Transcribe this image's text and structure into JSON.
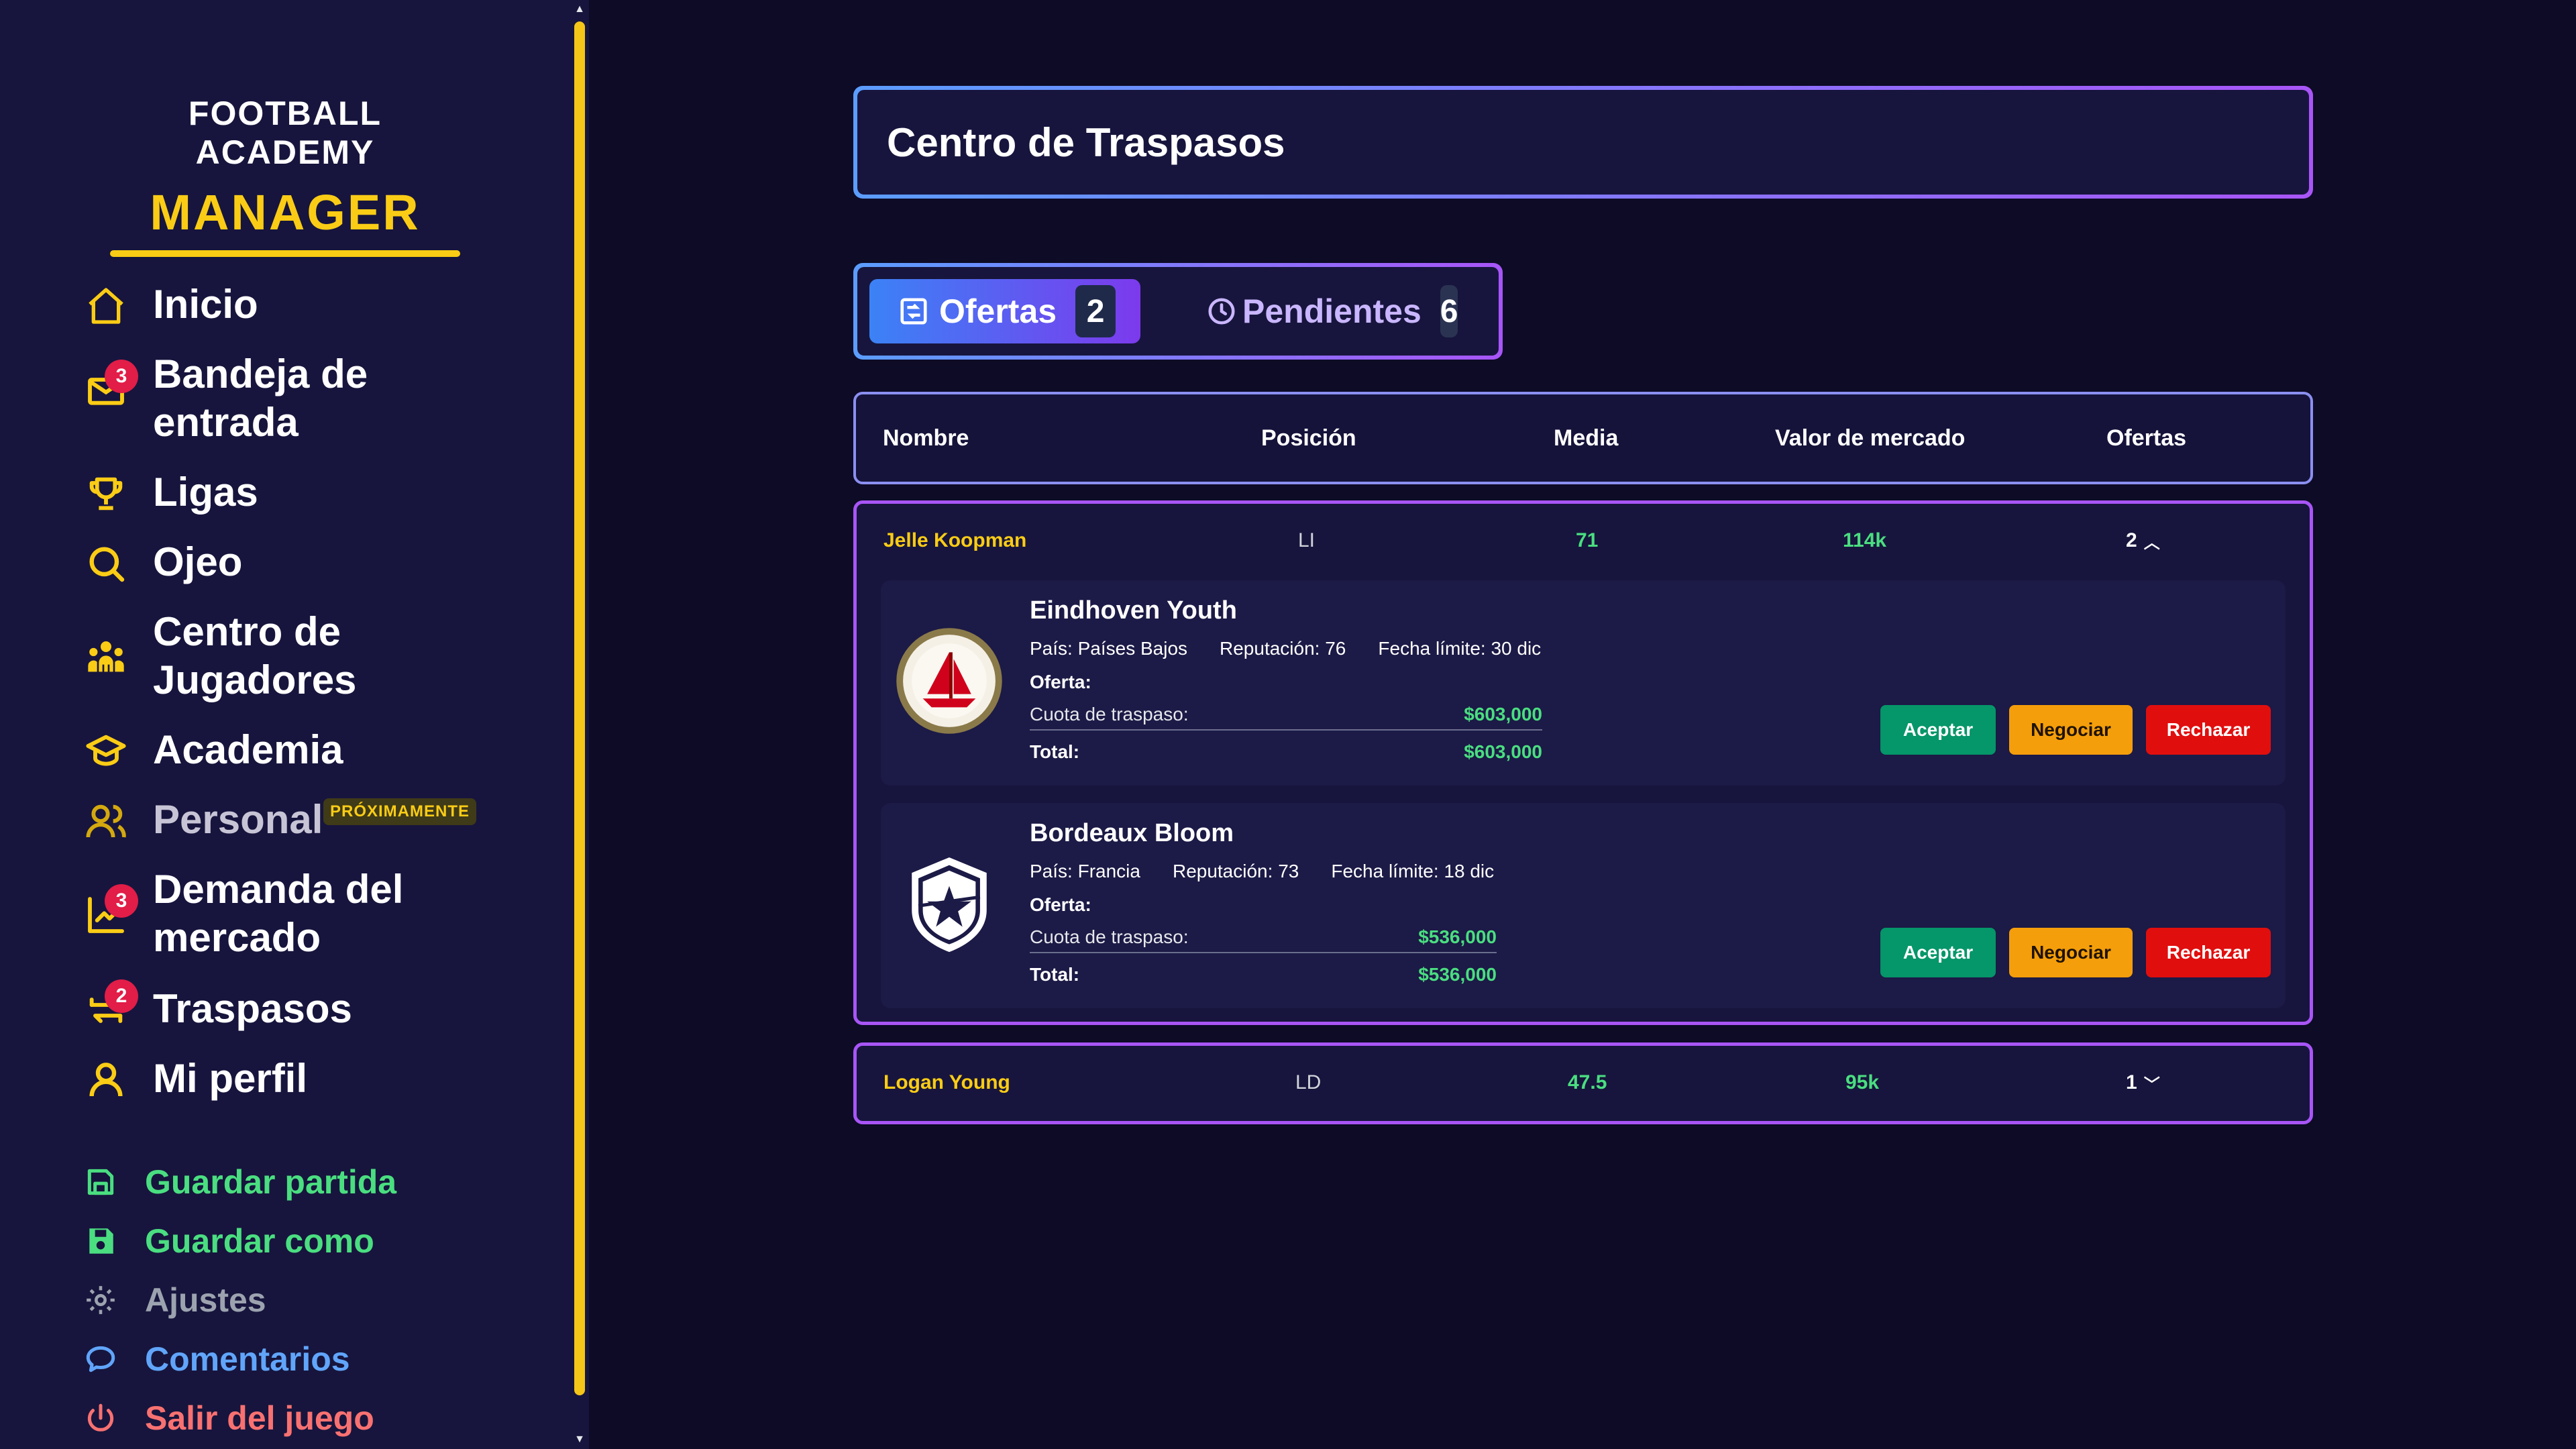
{
  "brand": {
    "top": "FOOTBALL ACADEMY",
    "main": "MANAGER"
  },
  "nav": [
    {
      "label": "Inicio",
      "icon": "home-icon"
    },
    {
      "label": "Bandeja de entrada",
      "icon": "mail-icon",
      "badge": "3"
    },
    {
      "label": "Ligas",
      "icon": "trophy-icon"
    },
    {
      "label": "Ojeo",
      "icon": "search-icon"
    },
    {
      "label": "Centro de Jugadores",
      "icon": "players-icon"
    },
    {
      "label": "Academia",
      "icon": "graduation-cap-icon"
    },
    {
      "label": "Personal",
      "icon": "staff-icon",
      "tag": "PRÓXIMAMENTE"
    },
    {
      "label": "Demanda del mercado",
      "icon": "chart-icon",
      "badge": "3"
    },
    {
      "label": "Traspasos",
      "icon": "transfer-icon",
      "badge": "2"
    },
    {
      "label": "Mi perfil",
      "icon": "user-icon"
    }
  ],
  "utility": [
    {
      "label": "Guardar partida",
      "icon": "save-icon",
      "color": "#4ade80"
    },
    {
      "label": "Guardar como",
      "icon": "save-as-icon",
      "color": "#4ade80"
    },
    {
      "label": "Ajustes",
      "icon": "gear-icon",
      "color": "#9ca3af"
    },
    {
      "label": "Comentarios",
      "icon": "comment-icon",
      "color": "#60a5fa"
    },
    {
      "label": "Salir del juego",
      "icon": "power-icon",
      "color": "#f87171"
    }
  ],
  "page": {
    "title": "Centro de Traspasos"
  },
  "tabs": [
    {
      "label": "Ofertas",
      "count": "2",
      "icon": "offers-icon",
      "active": true
    },
    {
      "label": "Pendientes",
      "count": "6",
      "icon": "clock-icon",
      "active": false
    }
  ],
  "table": {
    "headers": [
      "Nombre",
      "Posición",
      "Media",
      "Valor de mercado",
      "Ofertas"
    ]
  },
  "players": [
    {
      "name": "Jelle Koopman",
      "position": "LI",
      "rating": "71",
      "value": "114k",
      "offers": "2",
      "expanded": true,
      "offer_list": [
        {
          "club": "Eindhoven Youth",
          "country_key": "País:",
          "country": "Países Bajos",
          "rep_key": "Reputación:",
          "rep": "76",
          "deadline_key": "Fecha límite:",
          "deadline": "30 dic",
          "offer_label": "Oferta:",
          "fee_label": "Cuota de traspaso:",
          "fee": "$603,000",
          "total_label": "Total:",
          "total": "$603,000",
          "logo": "sailboat-crest-icon"
        },
        {
          "club": "Bordeaux Bloom",
          "country_key": "País:",
          "country": "Francia",
          "rep_key": "Reputación:",
          "rep": "73",
          "deadline_key": "Fecha límite:",
          "deadline": "18 dic",
          "offer_label": "Oferta:",
          "fee_label": "Cuota de traspaso:",
          "fee": "$536,000",
          "total_label": "Total:",
          "total": "$536,000",
          "logo": "star-shield-crest-icon"
        }
      ]
    },
    {
      "name": "Logan Young",
      "position": "LD",
      "rating": "47.5",
      "value": "95k",
      "offers": "1",
      "expanded": false
    }
  ],
  "actions": {
    "accept": "Aceptar",
    "negotiate": "Negociar",
    "reject": "Rechazar"
  },
  "colors": {
    "accent": "#facc15",
    "panel": "#17153d",
    "background": "#0d0b26",
    "value_green": "#4ade80",
    "border_purple": "#a855f7"
  }
}
